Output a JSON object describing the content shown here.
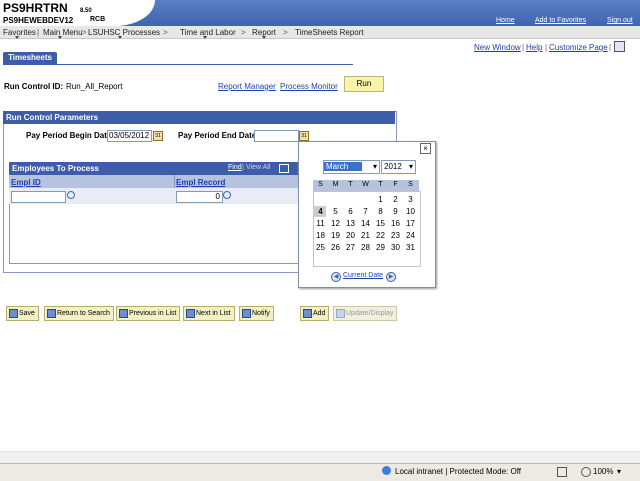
{
  "banner": {
    "system_name": "PS9HRTRN",
    "system_version": "8.50",
    "database": "PS9HEWEBDEV12",
    "user": "RCB",
    "links": [
      "Home",
      "Add to Favorites",
      "Sign out"
    ]
  },
  "menu": {
    "items": [
      "Favorites",
      "Main Menu",
      "LSUHSC Processes",
      "Time and Labor",
      "Report",
      "TimeSheets Report"
    ],
    "separators": ">"
  },
  "toolbar": {
    "new_window": "New Window",
    "help": "Help",
    "customize_page": "Customize Page"
  },
  "tab": {
    "label": "Timesheets"
  },
  "run_control": {
    "label": "Run Control ID:",
    "value": "Run_All_Report",
    "report_manager": "Report Manager",
    "process_monitor": "Process Monitor",
    "run_button": "Run"
  },
  "params": {
    "header": "Run Control Parameters",
    "begin_label": "Pay Period Begin Date:",
    "begin_value": "03/05/2012",
    "end_label": "Pay Period End Date:",
    "end_value": ""
  },
  "employees": {
    "header": "Employees To Process",
    "find": "Find",
    "view_all": "View All",
    "col_empl_id": "Empl ID",
    "col_empl_record": "Empl Record",
    "row_empl_id": "",
    "row_empl_record": "0"
  },
  "calendar": {
    "month": "March",
    "year": "2012",
    "weekdays": [
      "S",
      "M",
      "T",
      "W",
      "T",
      "F",
      "S"
    ],
    "weeks": [
      [
        "",
        "",
        "",
        "",
        "1",
        "2",
        "3"
      ],
      [
        "4",
        "5",
        "6",
        "7",
        "8",
        "9",
        "10"
      ],
      [
        "11",
        "12",
        "13",
        "14",
        "15",
        "16",
        "17"
      ],
      [
        "18",
        "19",
        "20",
        "21",
        "22",
        "23",
        "24"
      ],
      [
        "25",
        "26",
        "27",
        "28",
        "29",
        "30",
        "31"
      ]
    ],
    "selected_day": "4",
    "current_date": "Current Date"
  },
  "buttons": {
    "save": "Save",
    "return_to_search": "Return to Search",
    "previous_in_list": "Previous in List",
    "next_in_list": "Next in List",
    "notify": "Notify",
    "add": "Add",
    "update_display": "Update/Display"
  },
  "statusbar": {
    "zone": "Local intranet | Protected Mode: Off",
    "zoom": "100%"
  },
  "colors": {
    "header_blue": "#3d5da8",
    "link_blue": "#1f3faa",
    "button_yellow": "#f4f0c4"
  }
}
